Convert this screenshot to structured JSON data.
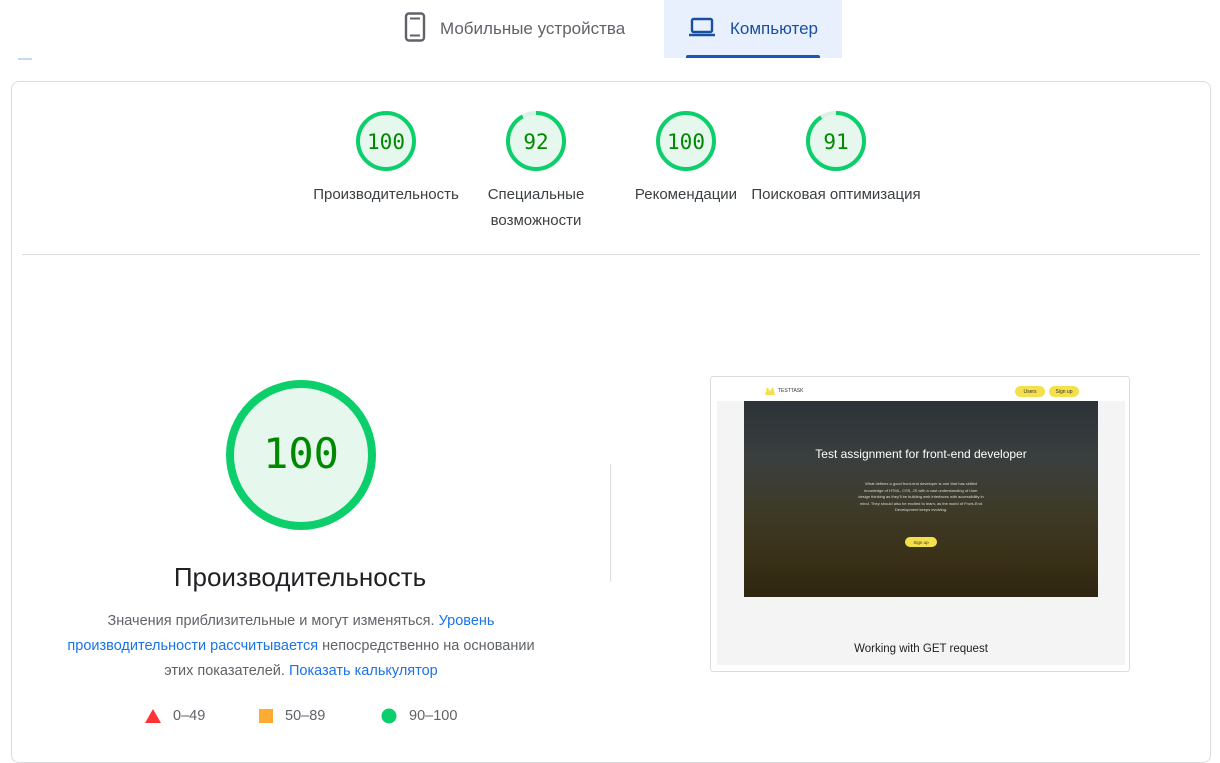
{
  "tabs": {
    "mobile_label": "Мобильные устройства",
    "desktop_label": "Компьютер"
  },
  "categories": [
    {
      "score": "100",
      "label": "Производительность",
      "value": 100
    },
    {
      "score": "92",
      "label": "Специальные возможности",
      "value": 92
    },
    {
      "score": "100",
      "label": "Рекомендации",
      "value": 100
    },
    {
      "score": "91",
      "label": "Поисковая оптимизация",
      "value": 91
    }
  ],
  "main": {
    "score": "100",
    "title": "Производительность",
    "desc_text1": "Значения приблизительные и могут изменяться. ",
    "desc_link1": "Уровень производительности рассчитывается",
    "desc_text2": " непосредственно на основании этих показателей. ",
    "desc_link2": "Показать калькулятор"
  },
  "legend": [
    {
      "range": "0–49",
      "color": "#ff3333",
      "shape": "triangle"
    },
    {
      "range": "50–89",
      "color": "#ffaa33",
      "shape": "square"
    },
    {
      "range": "90–100",
      "color": "#0cce6b",
      "shape": "circle"
    }
  ],
  "screenshot": {
    "logo": "TESTTASK",
    "btn_users": "Users",
    "btn_signup": "Sign up",
    "hero_title": "Test assignment for front-end developer",
    "hero_text": "What defines a good front-end developer is one that has skilled knowledge of HTML, CSS, JS with a vast understanding of User design thinking as they'll be building web interfaces with accessibility in mind. They should also be excited to learn, as the world of Front-End Development keeps evolving.",
    "hero_btn": "Sign up",
    "caption": "Working with GET request"
  },
  "colors": {
    "pass": "#0cce6b",
    "pass_text": "#008800",
    "pass_fill": "#e6f8ee",
    "accent": "#1a73e8"
  }
}
